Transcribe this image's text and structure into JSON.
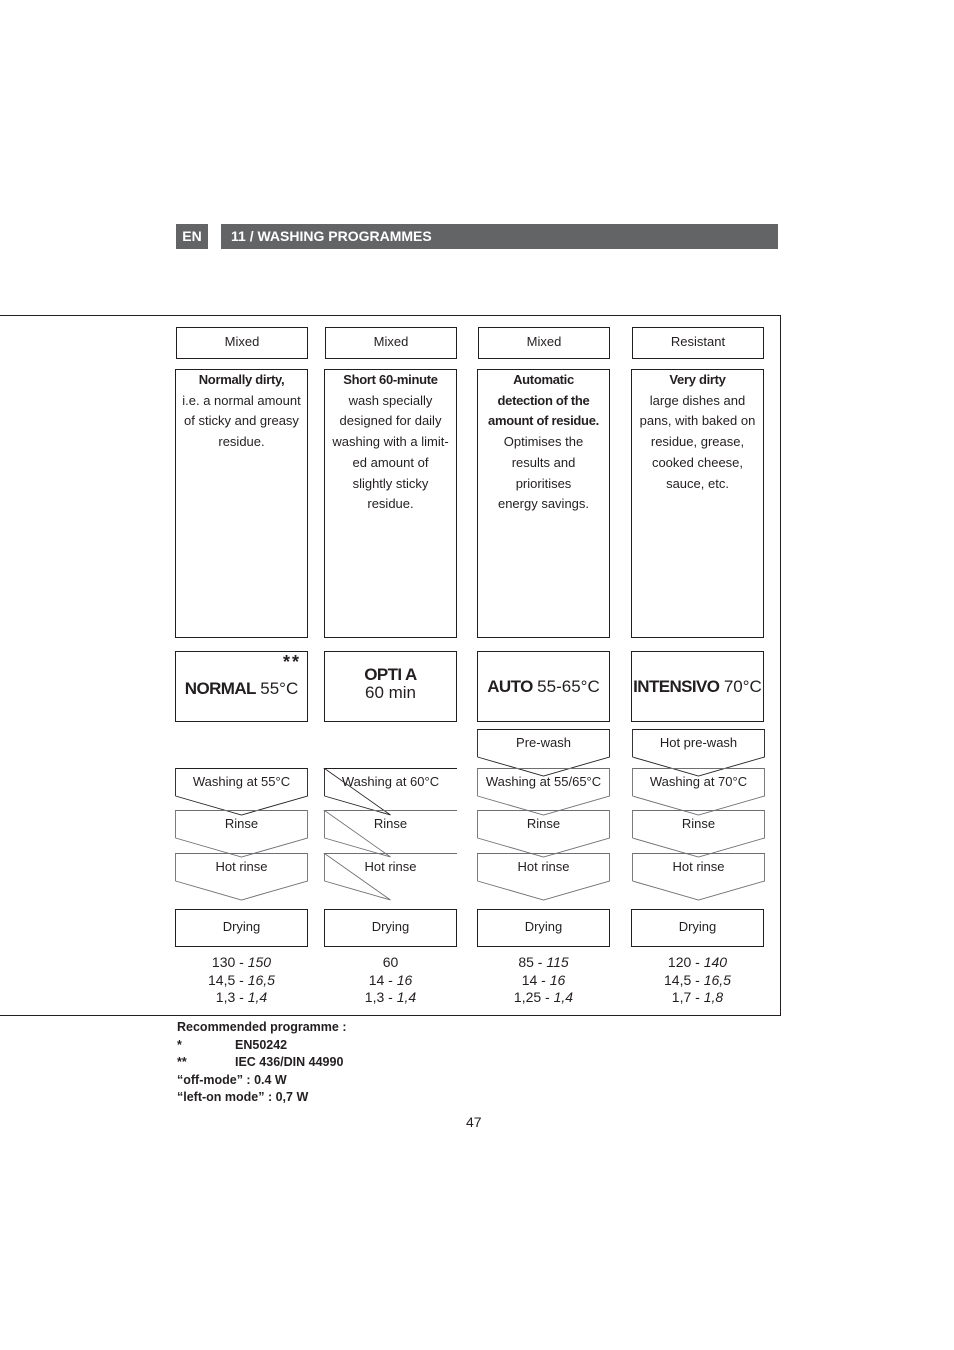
{
  "header": {
    "language": "EN",
    "section_title": "11 / WASHING PROGRAMMES"
  },
  "programmes": [
    {
      "type": "Mixed",
      "description_bold": [
        "Normally dirty,"
      ],
      "description": [
        "i.e. a normal amount",
        "of sticky and greasy",
        "residue."
      ],
      "name": "NORMAL",
      "temperature": "55°C",
      "subtitle": "",
      "marker": "**",
      "steps": [
        "Washing at 55°C",
        "Rinse",
        "Hot rinse"
      ],
      "drying": "Drying",
      "values": [
        {
          "min": "130",
          "max": "150"
        },
        {
          "min": "14,5",
          "max": "16,5"
        },
        {
          "min": "1,3",
          "max": "1,4"
        }
      ]
    },
    {
      "type": "Mixed",
      "description_bold": [
        "Short 60-minute"
      ],
      "description": [
        "wash specially",
        "designed for daily",
        "washing with a limit-",
        "ed amount of",
        "slightly sticky",
        "residue."
      ],
      "name": "OPTI A",
      "temperature": "",
      "subtitle": "60 min",
      "marker": "",
      "steps": [
        "Washing at 60°C",
        "Rinse",
        "Hot rinse"
      ],
      "drying": "Drying",
      "values": [
        {
          "min": "60",
          "max": ""
        },
        {
          "min": "14",
          "max": "16"
        },
        {
          "min": "1,3",
          "max": "1,4"
        }
      ]
    },
    {
      "type": "Mixed",
      "description_bold": [
        "Automatic",
        "detection of the",
        "amount of residue."
      ],
      "description": [
        "Optimises the",
        "results and",
        "prioritises",
        "energy savings."
      ],
      "name": "AUTO",
      "temperature": "55-65°C",
      "subtitle": "",
      "marker": "",
      "steps": [
        "Pre-wash",
        "Washing at 55/65°C",
        "Rinse",
        "Hot rinse"
      ],
      "drying": "Drying",
      "values": [
        {
          "min": "85",
          "max": "115"
        },
        {
          "min": "14",
          "max": "16"
        },
        {
          "min": "1,25",
          "max": "1,4"
        }
      ]
    },
    {
      "type": "Resistant",
      "description_bold": [
        "Very dirty"
      ],
      "description": [
        "large dishes and",
        "pans, with baked on",
        "residue, grease,",
        "cooked cheese,",
        "sauce, etc."
      ],
      "name": "INTENSIVO",
      "temperature": "70°C",
      "subtitle": "",
      "marker": "",
      "steps": [
        "Hot pre-wash",
        "Washing at 70°C",
        "Rinse",
        "Hot rinse"
      ],
      "drying": "Drying",
      "values": [
        {
          "min": "120",
          "max": "140"
        },
        {
          "min": "14,5",
          "max": "16,5"
        },
        {
          "min": "1,7",
          "max": "1,8"
        }
      ]
    }
  ],
  "notes": {
    "heading": "Recommended programme :",
    "standards": [
      {
        "symbol": "*",
        "label": "EN50242"
      },
      {
        "symbol": "**",
        "label": "IEC 436/DIN 44990"
      }
    ],
    "off_mode": "“off-mode” : 0.4 W",
    "left_on_mode": "“left-on mode” : 0,7 W"
  },
  "page_number": "47"
}
